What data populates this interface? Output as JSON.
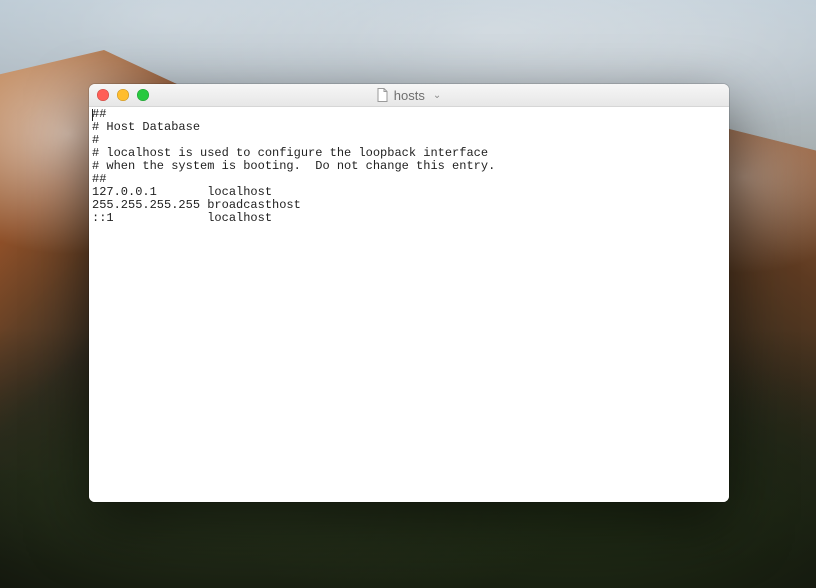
{
  "window": {
    "title": "hosts",
    "dropdown_indicator": "⌄"
  },
  "editor": {
    "content_lines": [
      "##",
      "# Host Database",
      "#",
      "# localhost is used to configure the loopback interface",
      "# when the system is booting.  Do not change this entry.",
      "##",
      "127.0.0.1       localhost",
      "255.255.255.255 broadcasthost",
      "::1             localhost"
    ]
  }
}
